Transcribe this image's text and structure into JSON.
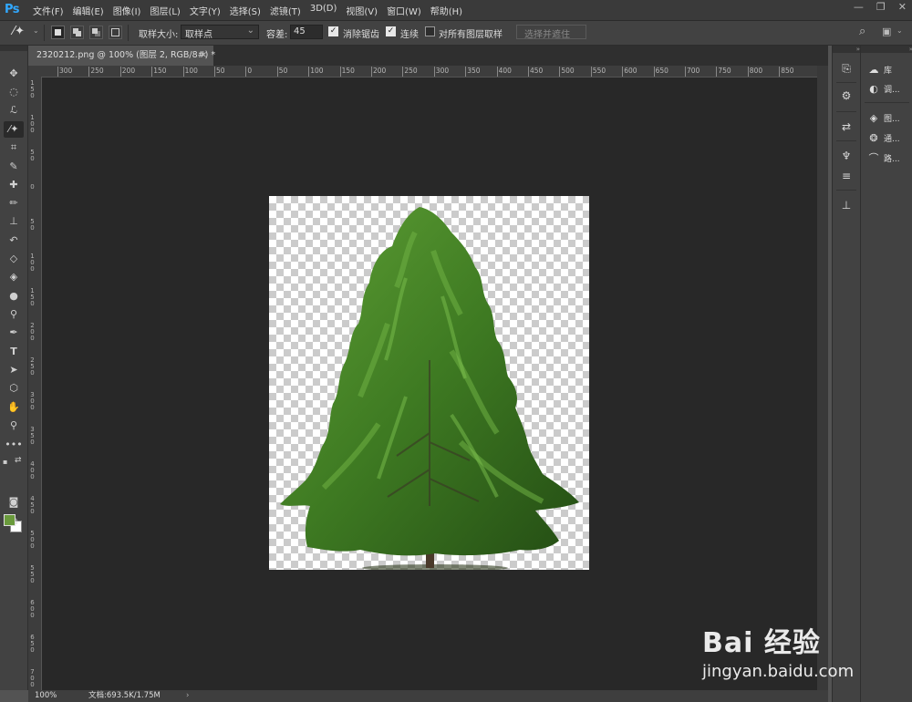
{
  "app": {
    "logo": "Ps"
  },
  "menubar": {
    "items": [
      "文件(F)",
      "编辑(E)",
      "图像(I)",
      "图层(L)",
      "文字(Y)",
      "选择(S)",
      "滤镜(T)",
      "3D(D)",
      "视图(V)",
      "窗口(W)",
      "帮助(H)"
    ]
  },
  "options_bar": {
    "sample_size_label": "取样大小:",
    "sample_size_value": "取样点",
    "tolerance_label": "容差:",
    "tolerance_value": "45",
    "anti_alias_label": "消除锯齿",
    "anti_alias_checked": true,
    "contiguous_label": "连续",
    "contiguous_checked": true,
    "sample_all_layers_label": "对所有图层取样",
    "sample_all_layers_checked": false,
    "select_and_mask_label": "选择并遮住 ..."
  },
  "document_tab": {
    "title": "2320212.png @ 100% (图层 2, RGB/8#) *",
    "close": "×"
  },
  "horizontal_ruler": {
    "labels": [
      "300",
      "250",
      "200",
      "150",
      "100",
      "50",
      "0",
      "50",
      "100",
      "150",
      "200",
      "250",
      "300",
      "350",
      "400",
      "450",
      "500",
      "550",
      "600",
      "650",
      "700",
      "750",
      "800",
      "850"
    ]
  },
  "vertical_ruler": {
    "labels": [
      "150",
      "100",
      "50",
      "0",
      "50",
      "100",
      "150",
      "200",
      "250",
      "300",
      "350",
      "400",
      "450",
      "500",
      "550",
      "600",
      "650",
      "700"
    ]
  },
  "status_bar": {
    "zoom": "100%",
    "doc_info": "文档:693.5K/1.75M",
    "arrow": "›"
  },
  "foreground_color": "#6a9a3c",
  "background_color": "#ffffff",
  "panels": {
    "items": [
      {
        "icon": "cloud-library-icon",
        "label": "库"
      },
      {
        "icon": "adjustments-icon",
        "label": "调..."
      },
      {
        "icon": "layers-icon",
        "label": "图..."
      },
      {
        "icon": "channels-icon",
        "label": "通..."
      },
      {
        "icon": "paths-icon",
        "label": "路..."
      }
    ]
  },
  "watermark": {
    "logo": "Bai 经验",
    "url": "jingyan.baidu.com"
  }
}
